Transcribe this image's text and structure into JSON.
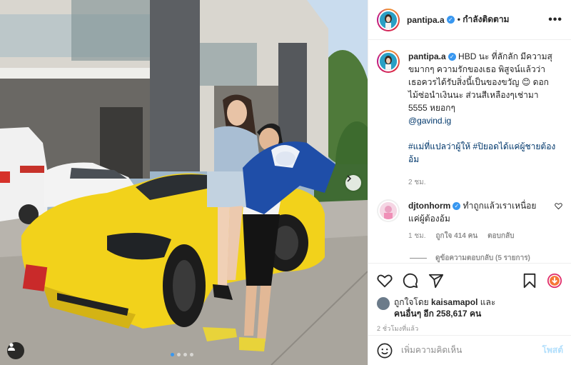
{
  "post": {
    "username": "pantipa.a",
    "follow_status": "• กำลังติดตาม",
    "more_label": "•••"
  },
  "caption": {
    "username": "pantipa.a",
    "text": "HBD นะ ที่ลักลัก มีความสุขมากๆ ความรักของเธอ พิสูจน์แล้วว่า เธอควรได้รับสิ่งนี้เป็นของขวัญ 😊 ดอกไม้ซ่อนำเงินนะ ส่วนสีเหลืองๆเช่ามา 5555 หยอกๆ",
    "mention": "@gavind.ig",
    "hashtags": "#แม่ที่แปลว่าผู้ให้ #ปิยอดได้แค่ผู้ชายต้องอ้ม",
    "time": "2 ชม."
  },
  "comment1": {
    "username": "djtonhorm",
    "text": "ทำถูกแล้วเราเหนื่อยแค่ผู้ต้องอ้ม",
    "time": "1 ชม.",
    "likes": "ถูกใจ 414 คน",
    "reply": "ตอบกลับ"
  },
  "replies": {
    "label": "ดูข้อความตอบกลับ (5 รายการ)"
  },
  "likes": {
    "prefix": "ถูกใจโดย",
    "user": "kaisamapol",
    "and": "และ",
    "others": "คนอื่นๆ อีก 258,617 คน"
  },
  "timestamp": "2 ชั่วโมงที่แล้ว",
  "add_comment": {
    "placeholder": "เพิ่มความคิดเห็น",
    "post_label": "โพสต์"
  },
  "icons": {
    "like": "heart-icon",
    "comment": "comment-icon",
    "share": "share-icon",
    "save": "bookmark-icon",
    "emoji": "emoji-icon",
    "next": "chevron-right-icon",
    "tag": "user-tag-icon",
    "verified": "verified-icon"
  },
  "colors": {
    "link": "#00376b",
    "muted": "#8e8e8e",
    "verified": "#3897f0",
    "post_disabled": "#b2dffc",
    "car": "#f2d21b"
  },
  "carousel": {
    "count": 4,
    "active": 1
  }
}
